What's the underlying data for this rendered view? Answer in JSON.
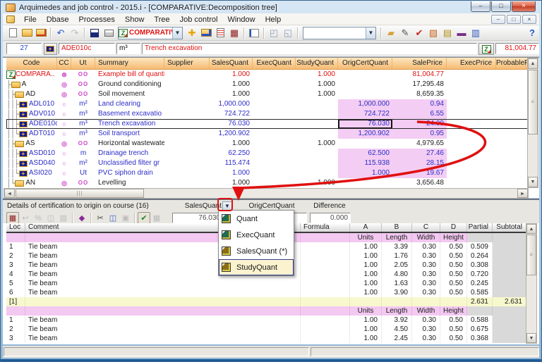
{
  "colors": {
    "annotation_red": "#e01010",
    "header_orange": "#f6ba72",
    "pink_cell": "#f3cdf3",
    "pink_header": "#f3c8f1",
    "subtotal_yellow": "#f8f8cf",
    "item_blue": "#2d2dc8",
    "root_red": "#e01010",
    "magenta_icon": "#cc44cc",
    "popup_highlight": "#fbf2cf"
  },
  "window": {
    "title": "Arquimedes and job control - 2015.i - [COMPARATIVE:Decomposition tree]",
    "menu": [
      "File",
      "Dbase",
      "Processes",
      "Show",
      "Tree",
      "Job control",
      "Window",
      "Help"
    ],
    "caption_buttons": {
      "minimize": "–",
      "maximize": "□",
      "close": "×"
    },
    "mdi_buttons": {
      "minimize": "–",
      "restore": "□",
      "close": "×"
    }
  },
  "toolbar": {
    "view_combo_value": "COMPARATIVE",
    "filter_combo_value": "",
    "help_label": "?",
    "main_icons": [
      {
        "n": "new-document-icon",
        "shape": "doc"
      },
      {
        "n": "open-folder-icon",
        "shape": "folder"
      },
      {
        "n": "open-edit-icon",
        "shape": "folder-edit"
      },
      {
        "sep": true
      },
      {
        "n": "undo-icon",
        "g": "↶",
        "c": "#2a5ad0"
      },
      {
        "n": "redo-icon",
        "g": "↷",
        "c": "#bdbdbd"
      },
      {
        "sep": true
      },
      {
        "n": "save-icon",
        "shape": "floppy"
      },
      {
        "n": "print-icon",
        "shape": "printer"
      },
      {
        "combo": "view"
      },
      {
        "n": "add-concept-icon",
        "g": "✚",
        "c": "#e8a400"
      },
      {
        "n": "chapter-folder-icon",
        "shape": "folder-blue"
      },
      {
        "n": "text-document-icon",
        "shape": "notes"
      },
      {
        "n": "budget-grid-icon",
        "g": "▦",
        "c": "#8b1c1c"
      },
      {
        "sep": true
      },
      {
        "n": "tree-view-icon",
        "shape": "tree"
      },
      {
        "sep": true
      },
      {
        "n": "window-horizontal-icon",
        "g": "◰",
        "c": "#8fa0b8"
      },
      {
        "n": "window-vertical-icon",
        "g": "◱",
        "c": "#8fa0b8"
      },
      {
        "sep": true
      },
      {
        "combo": "filter"
      },
      {
        "sep": true
      },
      {
        "n": "certificate-icon",
        "g": "▰",
        "c": "#d8a23a"
      },
      {
        "n": "pen-icon",
        "g": "✎",
        "c": "#555555"
      },
      {
        "n": "red-check-icon",
        "g": "✔",
        "c": "#cc2222"
      },
      {
        "n": "chart-icon",
        "g": "▧",
        "c": "#c8641a"
      },
      {
        "n": "clipboard-icon",
        "g": "▤",
        "c": "#b09018"
      },
      {
        "n": "ruler-icon",
        "g": "▬",
        "c": "#7a2a8a"
      },
      {
        "n": "report-icon",
        "g": "▥",
        "c": "#3355bb"
      }
    ]
  },
  "edit_row": {
    "row_number": "27",
    "code": "ADE010c",
    "unit": "m³",
    "summary": "Trench excavation",
    "amount": "81,004.77"
  },
  "tree": {
    "columns": [
      "Code",
      "CC",
      "Ut",
      "Summary",
      "Supplier",
      "SalesQuant",
      "ExecQuant",
      "StudyQuant",
      "OrigCertQuant",
      "SalePrice",
      "ExecPrice",
      "ProbablePrice"
    ],
    "rows": [
      {
        "type": "root",
        "pipes": "",
        "code": "COMPARA..",
        "cc": "⊗",
        "ut": "OO",
        "summary": "Example bill of quantities",
        "sales": "1.000",
        "exec": "",
        "study": "1.000",
        "orig_cert": "",
        "sale_price": "81,004.77"
      },
      {
        "type": "group",
        "pipes": "├",
        "code": "A",
        "cc": "◎",
        "ut": "OO",
        "summary": "Ground conditioning",
        "sales": "1.000",
        "exec": "",
        "study": "1.000",
        "orig_cert": "",
        "sale_price": "17,295.48"
      },
      {
        "type": "group",
        "pipes": "│├",
        "code": "AD",
        "cc": "◎",
        "ut": "OO",
        "summary": "Soil movement",
        "sales": "1.000",
        "exec": "",
        "study": "1.000",
        "orig_cert": "",
        "sale_price": "8,659.35"
      },
      {
        "type": "item",
        "pipes": "││├",
        "code": "ADL010",
        "cc": "○",
        "ut": "m²",
        "summary": "Land clearing",
        "sales": "1,000.000",
        "exec": "",
        "study": "",
        "orig_cert": "1,000.000",
        "sale_price": "0.94"
      },
      {
        "type": "item",
        "pipes": "││├",
        "code": "ADV010",
        "cc": "○",
        "ut": "m³",
        "summary": "Basement excavatio",
        "sales": "724.722",
        "exec": "",
        "study": "",
        "orig_cert": "724.722",
        "sale_price": "6.55"
      },
      {
        "type": "item",
        "pipes": "││├",
        "code": "ADE010c",
        "cc": "○",
        "ut": "m³",
        "summary": "Trench excavation",
        "sales": "76.030",
        "exec": "",
        "study": "",
        "orig_cert": "76.030",
        "sale_price": "24.09",
        "selected": true
      },
      {
        "type": "item",
        "pipes": "││└",
        "code": "ADT010",
        "cc": "○",
        "ut": "m³",
        "summary": "Soil transport",
        "sales": "1,200.902",
        "exec": "",
        "study": "",
        "orig_cert": "1,200.902",
        "sale_price": "0.95"
      },
      {
        "type": "group",
        "pipes": "│├",
        "code": "AS",
        "cc": "◎",
        "ut": "OO",
        "summary": "Horizontal wastewate",
        "sales": "1.000",
        "exec": "",
        "study": "1.000",
        "orig_cert": "",
        "sale_price": "4,979.65"
      },
      {
        "type": "item",
        "pipes": "││├",
        "code": "ASD010",
        "cc": "○",
        "ut": "m",
        "summary": "Drainage trench",
        "sales": "62.250",
        "exec": "",
        "study": "",
        "orig_cert": "62.500",
        "sale_price": "27.46"
      },
      {
        "type": "item",
        "pipes": "││├",
        "code": "ASD040",
        "cc": "○",
        "ut": "m²",
        "summary": "Unclassified filter gr",
        "sales": "115.474",
        "exec": "",
        "study": "",
        "orig_cert": "115.938",
        "sale_price": "28.15"
      },
      {
        "type": "item",
        "pipes": "││└",
        "code": "ASI020",
        "cc": "○",
        "ut": "Ut",
        "summary": "PVC siphon drain",
        "sales": "1.000",
        "exec": "",
        "study": "",
        "orig_cert": "1.000",
        "sale_price": "19.67"
      },
      {
        "type": "group",
        "pipes": "│└",
        "code": "AN",
        "cc": "◎",
        "ut": "OO",
        "summary": "Levelling",
        "sales": "1.000",
        "exec": "",
        "study": "1.000",
        "orig_cert": "",
        "sale_price": "3,656.48"
      }
    ]
  },
  "details": {
    "title": "Details of certification to origin on course (16)",
    "quant_label": "SalesQuant",
    "quant_value": "76.030",
    "orig_label": "OrigCertQuant",
    "orig_value": "",
    "diff_label": "Difference",
    "diff_value": "0.000",
    "columns": [
      "Loc",
      "Comment",
      "Formula",
      "A",
      "B",
      "C",
      "D",
      "Partial",
      "Subtotal"
    ],
    "units_header": [
      "Units",
      "Length",
      "Width",
      "Height"
    ],
    "toolbar_icons": [
      {
        "n": "edit-details-icon",
        "g": "▦",
        "c": "#8b1c1c",
        "pressed": true
      },
      {
        "n": "previous-detail-icon",
        "g": "↩",
        "c": "#bbbbbb"
      },
      {
        "n": "percent-icon",
        "g": "%",
        "c": "#bbbbbb"
      },
      {
        "n": "copy-rows-icon",
        "g": "◫",
        "c": "#bbbbbb"
      },
      {
        "n": "recalc-icon",
        "g": "▨",
        "c": "#bbbbbb"
      },
      {
        "sep": true
      },
      {
        "n": "book-icon",
        "g": "◆",
        "c": "#8a2a9a"
      },
      {
        "sep": true
      },
      {
        "n": "cut-icon",
        "g": "✂",
        "c": "#444444"
      },
      {
        "n": "copy-icon",
        "g": "◫",
        "c": "#3a62c8"
      },
      {
        "n": "paste-icon",
        "g": "▣",
        "c": "#bbbbbb"
      },
      {
        "sep": true
      },
      {
        "n": "apply-details-icon",
        "g": "✔",
        "c": "#18881a",
        "pressed": true
      },
      {
        "n": "export-details-icon",
        "g": "▦",
        "c": "#bbbbbb"
      }
    ],
    "rows": [
      {
        "k": "h"
      },
      {
        "k": "r",
        "loc": "1",
        "comment": "Tie beam",
        "a": "1.00",
        "b": "3.39",
        "c": "0.30",
        "d": "0.50",
        "partial": "0.509"
      },
      {
        "k": "r",
        "loc": "2",
        "comment": "Tie beam",
        "a": "1.00",
        "b": "1.76",
        "c": "0.30",
        "d": "0.50",
        "partial": "0.264"
      },
      {
        "k": "r",
        "loc": "3",
        "comment": "Tie beam",
        "a": "1.00",
        "b": "2.05",
        "c": "0.30",
        "d": "0.50",
        "partial": "0.308"
      },
      {
        "k": "r",
        "loc": "4",
        "comment": "Tie beam",
        "a": "1.00",
        "b": "4.80",
        "c": "0.30",
        "d": "0.50",
        "partial": "0.720"
      },
      {
        "k": "r",
        "loc": "5",
        "comment": "Tie beam",
        "a": "1.00",
        "b": "1.63",
        "c": "0.30",
        "d": "0.50",
        "partial": "0.245"
      },
      {
        "k": "r",
        "loc": "6",
        "comment": "Tie beam",
        "a": "1.00",
        "b": "3.90",
        "c": "0.30",
        "d": "0.50",
        "partial": "0.585"
      },
      {
        "k": "t",
        "loc": "[1]",
        "partial": "2.631",
        "subtotal": "2.631"
      },
      {
        "k": "h"
      },
      {
        "k": "r",
        "loc": "1",
        "comment": "Tie beam",
        "a": "1.00",
        "b": "3.92",
        "c": "0.30",
        "d": "0.50",
        "partial": "0.588"
      },
      {
        "k": "r",
        "loc": "2",
        "comment": "Tie beam",
        "a": "1.00",
        "b": "4.50",
        "c": "0.30",
        "d": "0.50",
        "partial": "0.675"
      },
      {
        "k": "r",
        "loc": "3",
        "comment": "Tie beam",
        "a": "1.00",
        "b": "2.45",
        "c": "0.30",
        "d": "0.50",
        "partial": "0.368"
      }
    ]
  },
  "popup": {
    "items": [
      {
        "label": "Quant",
        "icon": "quant-icon",
        "style": "p-teal"
      },
      {
        "label": "ExecQuant",
        "icon": "execquant-icon",
        "style": "p-teal"
      },
      {
        "label": "SalesQuant (*)",
        "icon": "salesquant-icon",
        "style": "p-gold"
      },
      {
        "label": "StudyQuant",
        "icon": "studyquant-icon",
        "style": "p-gold",
        "highlighted": true
      }
    ]
  }
}
